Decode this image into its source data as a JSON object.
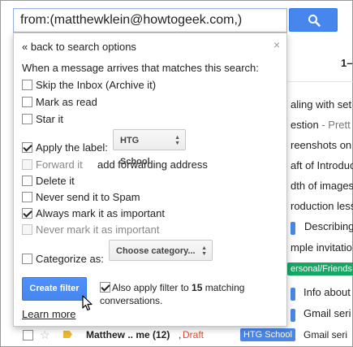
{
  "search": {
    "query": "from:(matthewklein@howtogeek.com,)"
  },
  "panel": {
    "back_link": "« back to search options",
    "close": "×",
    "intro": "When a message arrives that matches this search:",
    "options": {
      "skip_inbox": "Skip the Inbox (Archive it)",
      "mark_read": "Mark as read",
      "star": "Star it",
      "apply_label": "Apply the label:",
      "label_value": "HTG School",
      "forward": "Forward it",
      "add_forwarding": "add forwarding address",
      "delete": "Delete it",
      "never_spam": "Never send it to Spam",
      "always_important": "Always mark it as important",
      "never_important": "Never mark it as important",
      "categorize": "Categorize as:",
      "category_value": "Choose category..."
    },
    "create_filter": "Create filter",
    "also_apply_prefix": "Also apply filter to ",
    "also_apply_count": "15",
    "also_apply_suffix": " matching conversations.",
    "learn_more": "Learn more"
  },
  "background": {
    "page_indicator": "1–",
    "snippets": [
      "aling with set",
      "estion",
      "- Prett",
      "reenshots on",
      "aft of Introduc",
      "dth of images",
      "roduction less",
      "Describing",
      "mple invitatio",
      "ersonal/Friends",
      "Info about",
      "Gmail seri",
      "Gmail seri"
    ],
    "bottom_row": {
      "sender": "Matthew .. me (12)",
      "draft": "Draft",
      "label": "HTG School",
      "subject": "Gmail seri"
    }
  },
  "colors": {
    "accent": "#4787ed",
    "link": "#1155cc",
    "draft": "#dd4b39",
    "label_blue": "#4a86e8",
    "label_green": "#16a765"
  }
}
